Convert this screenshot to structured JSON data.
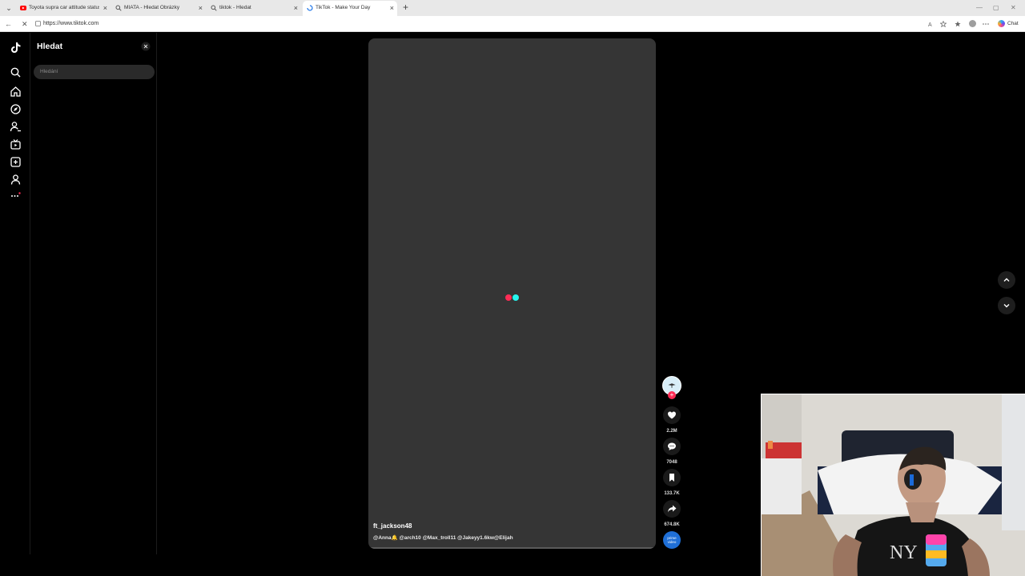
{
  "browser": {
    "tabs": [
      {
        "title": "Toyota supra car attitude status -",
        "favicon": "youtube-icon",
        "active": false
      },
      {
        "title": "MIATA - Hledat Obrázky",
        "favicon": "search-icon",
        "active": false
      },
      {
        "title": "tiktok - Hledat",
        "favicon": "search-icon",
        "active": false
      },
      {
        "title": "TikTok - Make Your Day",
        "favicon": "loading-icon",
        "active": true
      }
    ],
    "new_tab_symbol": "+",
    "url": "https://www.tiktok.com",
    "chat_label": "Chat"
  },
  "sidebar": {
    "icons": [
      "search-icon",
      "home-icon",
      "explore-icon",
      "following-icon",
      "live-icon",
      "upload-icon",
      "profile-icon",
      "more-icon"
    ]
  },
  "search_panel": {
    "title": "Hledat",
    "placeholder": "Hledání"
  },
  "video": {
    "username": "ft_jackson48",
    "caption": "@Anna🔔 @arch10 @Max_troll11 @Jakeyy1.6kw@Elijah",
    "loader_colors": [
      "#fe2c55",
      "#25f4ee"
    ]
  },
  "actions": {
    "likes": "2.2M",
    "comments": "7048",
    "saves": "133.7K",
    "shares": "674.8K",
    "music_label": "prime video"
  },
  "colors": {
    "accent_red": "#fe2c55",
    "accent_cyan": "#25f4ee",
    "video_bg": "#353535"
  }
}
